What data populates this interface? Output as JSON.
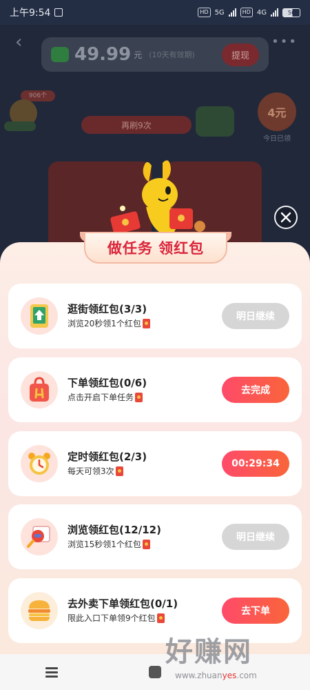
{
  "status_bar": {
    "time": "上午9:54",
    "sim1": "HD",
    "net1": "5G",
    "sim2": "HD",
    "net2": "4G",
    "battery": "56"
  },
  "background": {
    "balance_amount": "49.99",
    "balance_unit": "元",
    "balance_note": "(10天有效期)",
    "withdraw_label": "提现",
    "coin_count": "906个",
    "remaining_label": "再刷9次",
    "today_amount": "4元",
    "today_label": "今日已领"
  },
  "sheet": {
    "title": "做任务 领红包"
  },
  "tasks": [
    {
      "title": "逛街领红包(3/3)",
      "subtitle": "浏览20秒领1个红包",
      "button": "明日继续",
      "button_state": "disabled",
      "icon": "shopping-phone-icon"
    },
    {
      "title": "下单领红包(0/6)",
      "subtitle": "点击开启下单任务",
      "button": "去完成",
      "button_state": "active",
      "icon": "shopping-bag-icon"
    },
    {
      "title": "定时领红包(2/3)",
      "subtitle": "每天可领3次",
      "button": "00:29:34",
      "button_state": "active",
      "icon": "alarm-clock-icon"
    },
    {
      "title": "浏览领红包(12/12)",
      "subtitle": "浏览15秒领1个红包",
      "button": "明日继续",
      "button_state": "disabled",
      "icon": "magnifier-icon"
    },
    {
      "title": "去外卖下单领红包(0/1)",
      "subtitle": "限此入口下单领9个红包",
      "button": "去下单",
      "button_state": "active",
      "icon": "burger-icon"
    }
  ],
  "watermark": {
    "big": "好赚网",
    "small_prefix": "www.zhuan",
    "small_accent": "yes",
    "small_suffix": ".com"
  },
  "colors": {
    "accent_red": "#ff4a6a",
    "accent_orange": "#f9653a",
    "title_red": "#d9263b",
    "disabled_grey": "#d6d6d6"
  }
}
